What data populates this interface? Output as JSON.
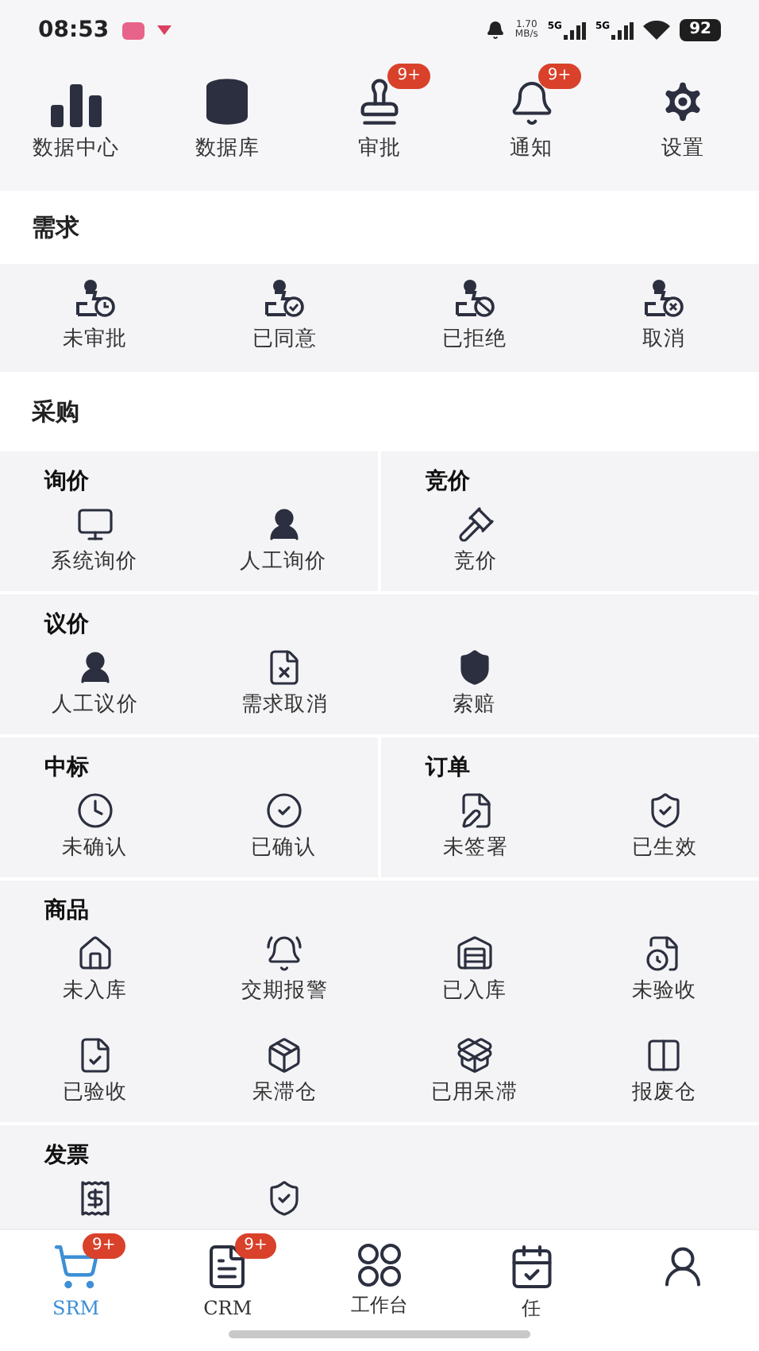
{
  "status_bar": {
    "time": "08:53",
    "net_speed": "1.70",
    "net_unit": "MB/s",
    "signal_labels": [
      "5G",
      "5G"
    ],
    "battery": "92"
  },
  "shortcuts": [
    {
      "label": "数据中心"
    },
    {
      "label": "数据库"
    },
    {
      "label": "审批",
      "badge": "9+"
    },
    {
      "label": "通知",
      "badge": "9+"
    },
    {
      "label": "设置"
    }
  ],
  "demand": {
    "title": "需求",
    "items": [
      {
        "label": "未审批"
      },
      {
        "label": "已同意"
      },
      {
        "label": "已拒绝"
      },
      {
        "label": "取消"
      }
    ]
  },
  "purchase": {
    "title": "采购",
    "rows": [
      {
        "groups": [
          {
            "title": "询价",
            "items": [
              {
                "kind": "labeled",
                "label": "系统询价"
              },
              {
                "kind": "labeled",
                "label": "人工询价"
              }
            ]
          },
          {
            "title": "竞价",
            "items": [
              {
                "kind": "labeled",
                "label": "竞价"
              }
            ]
          }
        ]
      },
      {
        "groups": [
          {
            "title": "议价",
            "items": [
              {
                "kind": "labeled",
                "label": "人工议价"
              },
              {
                "kind": "labeled",
                "label": "需求取消"
              },
              {
                "kind": "labeled",
                "label": "索赔"
              }
            ]
          }
        ]
      },
      {
        "groups": [
          {
            "title": "中标",
            "items": [
              {
                "kind": "labeled",
                "label": "未确认"
              },
              {
                "kind": "labeled",
                "label": "已确认"
              }
            ]
          },
          {
            "title": "订单",
            "items": [
              {
                "kind": "labeled",
                "label": "未签署"
              },
              {
                "kind": "labeled",
                "label": "已生效"
              }
            ]
          }
        ]
      },
      {
        "groups": [
          {
            "title": "商品",
            "items": [
              {
                "kind": "labeled",
                "label": "未入库"
              },
              {
                "kind": "labeled",
                "label": "交期报警"
              },
              {
                "kind": "labeled",
                "label": "已入库"
              },
              {
                "kind": "labeled",
                "label": "未验收"
              },
              {
                "kind": "labeled",
                "label": "已验收"
              },
              {
                "kind": "labeled",
                "label": "呆滞仓"
              },
              {
                "kind": "labeled",
                "label": "已用呆滞"
              },
              {
                "kind": "labeled",
                "label": "报废仓"
              }
            ]
          }
        ]
      },
      {
        "groups": [
          {
            "title": "发票",
            "items": [
              {
                "kind": "icon_only"
              },
              {
                "kind": "icon_only"
              }
            ]
          }
        ]
      }
    ]
  },
  "tab_bar": [
    {
      "label": "SRM",
      "selected": true,
      "badge": "9+"
    },
    {
      "label": "CRM",
      "selected": false,
      "badge": "9+"
    },
    {
      "label": "工作台",
      "selected": false
    },
    {
      "label": "任",
      "selected": false
    },
    {
      "selected": false
    }
  ]
}
